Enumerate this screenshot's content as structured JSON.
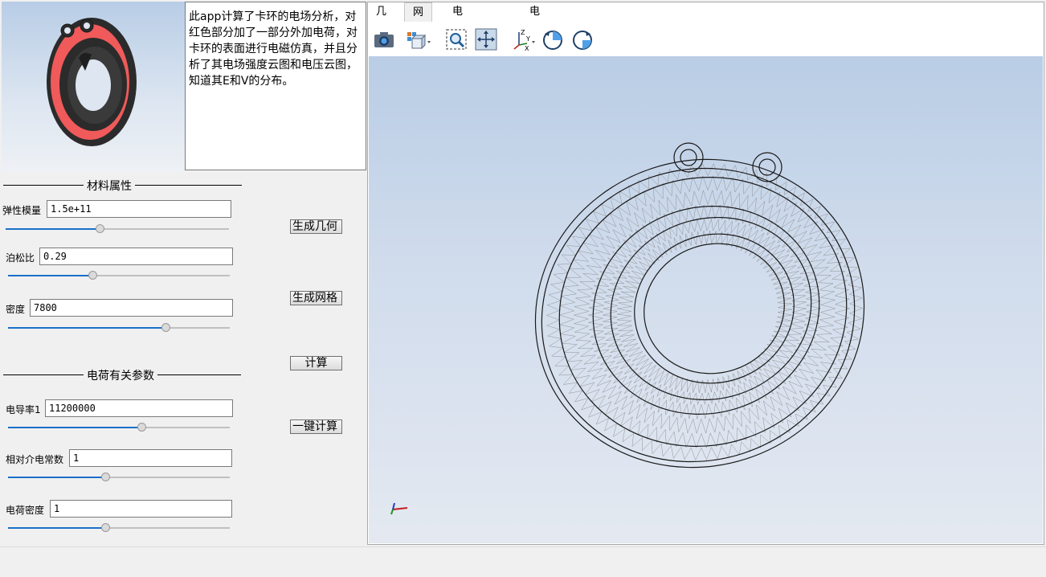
{
  "description": "此app计算了卡环的电场分析，对红色部分加了一部分外加电荷，对卡环的表面进行电磁仿真，并且分析了其电场强度云图和电压云图，知道其E和V的分布。",
  "material": {
    "title": "材料属性",
    "elastic_label": "弹性模量",
    "elastic_value": "1.5e+11",
    "elastic_slider": 0.42,
    "poisson_label": "泊松比",
    "poisson_value": "0.29",
    "poisson_slider": 0.38,
    "density_label": "密度",
    "density_value": "7800",
    "density_slider": 0.71
  },
  "charge": {
    "title": "电荷有关参数",
    "conductivity_label": "电导率1",
    "conductivity_value": "11200000",
    "conductivity_slider": 0.6,
    "permittivity_label": "相对介电常数",
    "permittivity_value": "1",
    "permittivity_slider": 0.44,
    "density_label": "电荷密度",
    "density_value": "1",
    "density_slider": 0.44
  },
  "buttons": {
    "geometry": "生成几何",
    "mesh": "生成网格",
    "compute": "计算",
    "one_click": "一键计算"
  },
  "tabs": [
    "几何",
    "网格",
    "电场强度云图",
    "电压云图"
  ],
  "active_tab": "网格",
  "toolbar_icons": [
    "camera-icon",
    "view-cube-icon",
    "zoom-box-icon",
    "fit-view-icon",
    "axis-orientation-icon",
    "rotate-ccw-icon",
    "rotate-cw-icon"
  ],
  "colors": {
    "accent": "#1a6fc9",
    "ring_red": "#f05a5a",
    "ring_dark": "#2b2b2b",
    "mesh_line": "#3a3a3a"
  }
}
